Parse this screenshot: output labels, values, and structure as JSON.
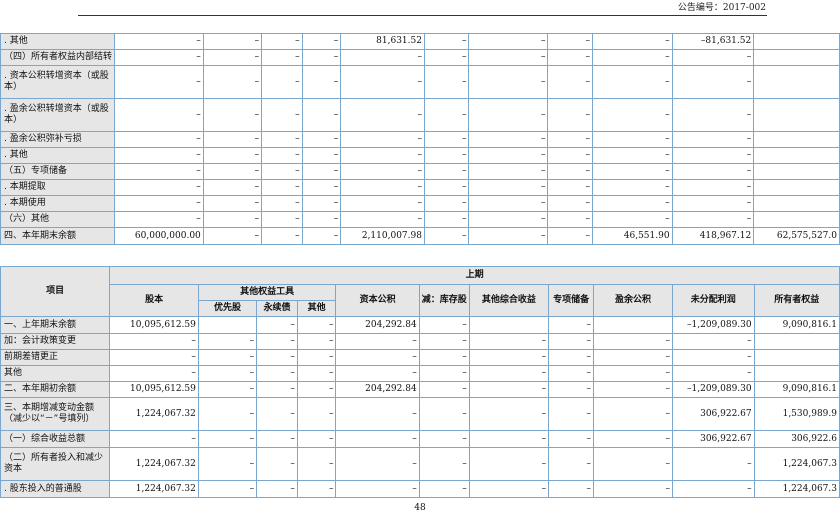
{
  "header": {
    "announcement_no": "公告编号：2017-002"
  },
  "page_number": "48",
  "table_top": {
    "rows": [
      {
        "label": ". 其他",
        "values": [
          "–",
          "–",
          "–",
          "–",
          "81,631.52",
          "–",
          "–",
          "–",
          "–",
          "–81,631.52",
          ""
        ]
      },
      {
        "label": "（四）所有者权益内部结转",
        "values": [
          "–",
          "–",
          "–",
          "–",
          "–",
          "–",
          "–",
          "–",
          "–",
          "–",
          ""
        ]
      },
      {
        "label": ". 资本公积转增资本（或股本）",
        "values": [
          "–",
          "–",
          "–",
          "–",
          "–",
          "–",
          "–",
          "–",
          "–",
          "–",
          ""
        ]
      },
      {
        "label": ". 盈余公积转增资本（或股本）",
        "values": [
          "–",
          "–",
          "–",
          "–",
          "–",
          "–",
          "–",
          "–",
          "–",
          "–",
          ""
        ]
      },
      {
        "label": ". 盈余公积弥补亏损",
        "values": [
          "–",
          "–",
          "–",
          "–",
          "–",
          "–",
          "–",
          "–",
          "–",
          "–",
          ""
        ]
      },
      {
        "label": ". 其他",
        "values": [
          "–",
          "–",
          "–",
          "–",
          "–",
          "–",
          "–",
          "–",
          "–",
          "–",
          ""
        ]
      },
      {
        "label": "（五）专项储备",
        "values": [
          "–",
          "–",
          "–",
          "–",
          "–",
          "–",
          "–",
          "–",
          "–",
          "–",
          ""
        ]
      },
      {
        "label": ". 本期提取",
        "values": [
          "–",
          "–",
          "–",
          "–",
          "–",
          "–",
          "–",
          "–",
          "–",
          "–",
          ""
        ]
      },
      {
        "label": ". 本期使用",
        "values": [
          "–",
          "–",
          "–",
          "–",
          "–",
          "–",
          "–",
          "–",
          "–",
          "–",
          ""
        ]
      },
      {
        "label": "（六）其他",
        "values": [
          "–",
          "–",
          "–",
          "–",
          "–",
          "–",
          "–",
          "–",
          "–",
          "–",
          ""
        ]
      },
      {
        "label": "四、本年期末余额",
        "values": [
          "60,000,000.00",
          "–",
          "–",
          "–",
          "2,110,007.98",
          "–",
          "–",
          "–",
          "46,551.90",
          "418,967.12",
          "62,575,527.0"
        ]
      }
    ]
  },
  "table_bottom": {
    "period": "上期",
    "headers": {
      "item": "项目",
      "share_capital": "股本",
      "other_equity_instruments": "其他权益工具",
      "preferred": "优先股",
      "perpetual": "永续债",
      "other": "其他",
      "capital_reserve": "资本公积",
      "treasury_stock": "减：库存股",
      "other_comprehensive_income": "其他综合收益",
      "special_reserve": "专项储备",
      "surplus_reserve": "盈余公积",
      "undistributed_profit": "未分配利润",
      "total_equity": "所有者权益"
    },
    "rows": [
      {
        "label": "一、上年期末余额",
        "values": [
          "10,095,612.59",
          "",
          "–",
          "–",
          "204,292.84",
          "–",
          "",
          "–",
          "",
          "–1,209,089.30",
          "9,090,816.1"
        ]
      },
      {
        "label": "加：会计政策变更",
        "values": [
          "–",
          "–",
          "–",
          "–",
          "–",
          "–",
          "–",
          "–",
          "–",
          "–",
          ""
        ]
      },
      {
        "label": "前期差错更正",
        "values": [
          "–",
          "–",
          "–",
          "–",
          "–",
          "–",
          "–",
          "–",
          "–",
          "–",
          ""
        ]
      },
      {
        "label": "其他",
        "values": [
          "–",
          "–",
          "–",
          "–",
          "–",
          "–",
          "–",
          "–",
          "–",
          "–",
          ""
        ]
      },
      {
        "label": "二、本年期初余额",
        "values": [
          "10,095,612.59",
          "–",
          "–",
          "–",
          "204,292.84",
          "–",
          "–",
          "–",
          "–",
          "–1,209,089.30",
          "9,090,816.1"
        ]
      },
      {
        "label": "三、本期增减变动金额（减少以“－”号填列）",
        "values": [
          "1,224,067.32",
          "–",
          "–",
          "–",
          "–",
          "–",
          "–",
          "–",
          "–",
          "306,922.67",
          "1,530,989.9"
        ]
      },
      {
        "label": "（一）综合收益总额",
        "values": [
          "–",
          "–",
          "–",
          "–",
          "–",
          "–",
          "–",
          "–",
          "–",
          "306,922.67",
          "306,922.6"
        ]
      },
      {
        "label": "（二）所有者投入和减少资本",
        "values": [
          "1,224,067.32",
          "–",
          "–",
          "–",
          "–",
          "–",
          "–",
          "–",
          "–",
          "–",
          "1,224,067.3"
        ]
      },
      {
        "label": ". 股东投入的普通股",
        "values": [
          "1,224,067.32",
          "–",
          "–",
          "–",
          "–",
          "–",
          "–",
          "–",
          "–",
          "–",
          "1,224,067.3"
        ]
      }
    ]
  }
}
